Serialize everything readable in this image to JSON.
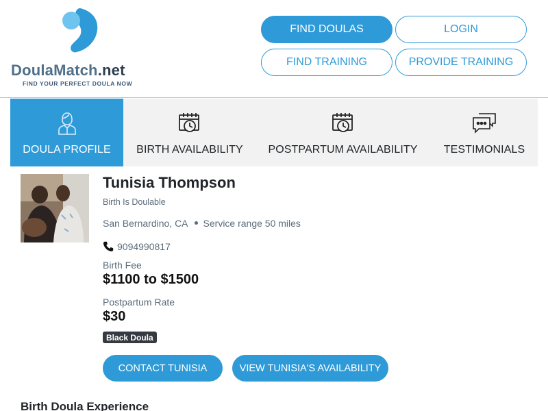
{
  "logo": {
    "brand_main": "DoulaMatch",
    "brand_suffix": ".net",
    "tagline": "FIND YOUR PERFECT DOULA NOW",
    "mark_colors": [
      "#2e9ad8",
      "#6fc3ef"
    ]
  },
  "header": {
    "find_doulas": "FIND DOULAS",
    "login": "LOGIN",
    "find_training": "FIND TRAINING",
    "provide_training": "PROVIDE TRAINING"
  },
  "tabs": [
    {
      "label": "DOULA PROFILE",
      "icon": "doula-person-icon",
      "active": true
    },
    {
      "label": "BIRTH AVAILABILITY",
      "icon": "calendar-clock-icon",
      "active": false
    },
    {
      "label": "POSTPARTUM AVAILABILITY",
      "icon": "calendar-clock-icon",
      "active": false
    },
    {
      "label": "TESTIMONIALS",
      "icon": "chat-bubbles-icon",
      "active": false
    }
  ],
  "profile": {
    "name": "Tunisia Thompson",
    "business": "Birth Is Doulable",
    "city": "San Bernardino, CA",
    "service_range": "Service range 50 miles",
    "phone": "9094990817",
    "birth_fee_label": "Birth Fee",
    "birth_fee": "$1100 to $1500",
    "postpartum_label": "Postpartum Rate",
    "postpartum_rate": "$30",
    "badge": "Black Doula",
    "contact_button": "CONTACT TUNISIA",
    "availability_button": "VIEW TUNISIA'S AVAILABILITY"
  },
  "section": {
    "experience_title": "Birth Doula Experience"
  },
  "colors": {
    "accent": "#2e9ad8",
    "tab_bg": "#f2f2f2",
    "muted_text": "#5a6b7a",
    "badge_bg": "#343a40"
  }
}
